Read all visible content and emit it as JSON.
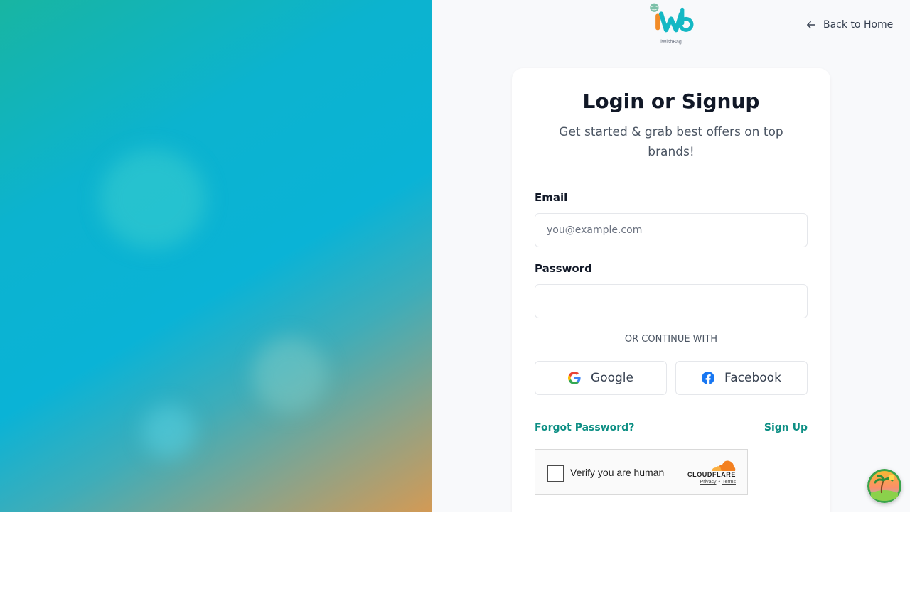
{
  "brand": {
    "logo_text": "iWishBag"
  },
  "nav": {
    "back_home_label": "Back to Home"
  },
  "form": {
    "title": "Login or Signup",
    "subtitle": "Get started & grab best offers on top brands!",
    "email_label": "Email",
    "email_placeholder": "you@example.com",
    "email_value": "",
    "password_label": "Password",
    "password_value": "",
    "divider_text": "OR CONTINUE WITH",
    "google_label": "Google",
    "facebook_label": "Facebook",
    "forgot_label": "Forgot Password?",
    "signup_label": "Sign Up"
  },
  "captcha": {
    "label": "Verify you are human",
    "brand": "CLOUDFLARE",
    "privacy": "Privacy",
    "terms": "Terms"
  },
  "colors": {
    "accent": "#0d8f84",
    "panel_bg": "#f8f9fb",
    "hero_start": "#18b5a2",
    "hero_mid": "#0ab3d6",
    "hero_end": "#d39a55"
  },
  "icons": {
    "back": "arrow-left-icon",
    "google": "google-icon",
    "facebook": "facebook-icon",
    "cloudflare": "cloudflare-logo",
    "floating": "beach-island-icon"
  }
}
